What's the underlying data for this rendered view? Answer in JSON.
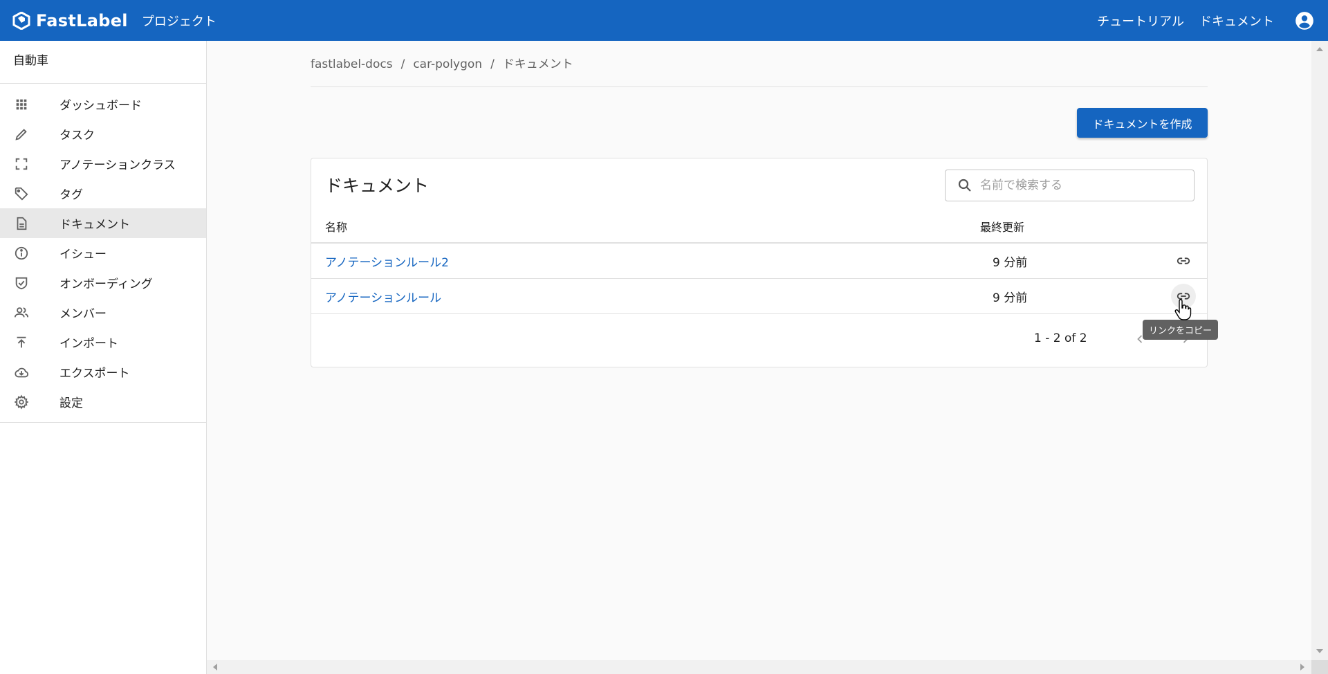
{
  "header": {
    "brand": "FastLabel",
    "project_link": "プロジェクト",
    "tutorial_link": "チュートリアル",
    "docs_link": "ドキュメント",
    "account_icon": "account-circle-icon",
    "bg_color": "#1565c0"
  },
  "sidebar": {
    "project_name": "自動車",
    "items": [
      {
        "label": "ダッシュボード",
        "icon": "apps-grid-icon"
      },
      {
        "label": "タスク",
        "icon": "pencil-icon"
      },
      {
        "label": "アノテーションクラス",
        "icon": "crop-free-icon"
      },
      {
        "label": "タグ",
        "icon": "tag-icon"
      },
      {
        "label": "ドキュメント",
        "icon": "document-icon",
        "active": true
      },
      {
        "label": "イシュー",
        "icon": "info-icon"
      },
      {
        "label": "オンボーディング",
        "icon": "shield-check-icon"
      },
      {
        "label": "メンバー",
        "icon": "people-icon"
      },
      {
        "label": "インポート",
        "icon": "upload-icon"
      },
      {
        "label": "エクスポート",
        "icon": "cloud-download-icon"
      },
      {
        "label": "設定",
        "icon": "gear-icon"
      }
    ]
  },
  "breadcrumb": [
    "fastlabel-docs",
    "car-polygon",
    "ドキュメント"
  ],
  "breadcrumb_separator": "/",
  "create_button": "ドキュメントを作成",
  "card": {
    "title": "ドキュメント",
    "search_placeholder": "名前で検索する",
    "columns": {
      "name": "名称",
      "updated": "最終更新"
    },
    "rows": [
      {
        "name": "アノテーションルール2",
        "updated": "9 分前"
      },
      {
        "name": "アノテーションルール",
        "updated": "9 分前"
      }
    ],
    "pagination": "1 - 2 of 2"
  },
  "tooltip": "リンクをコピー",
  "accent_color": "#1565c0"
}
